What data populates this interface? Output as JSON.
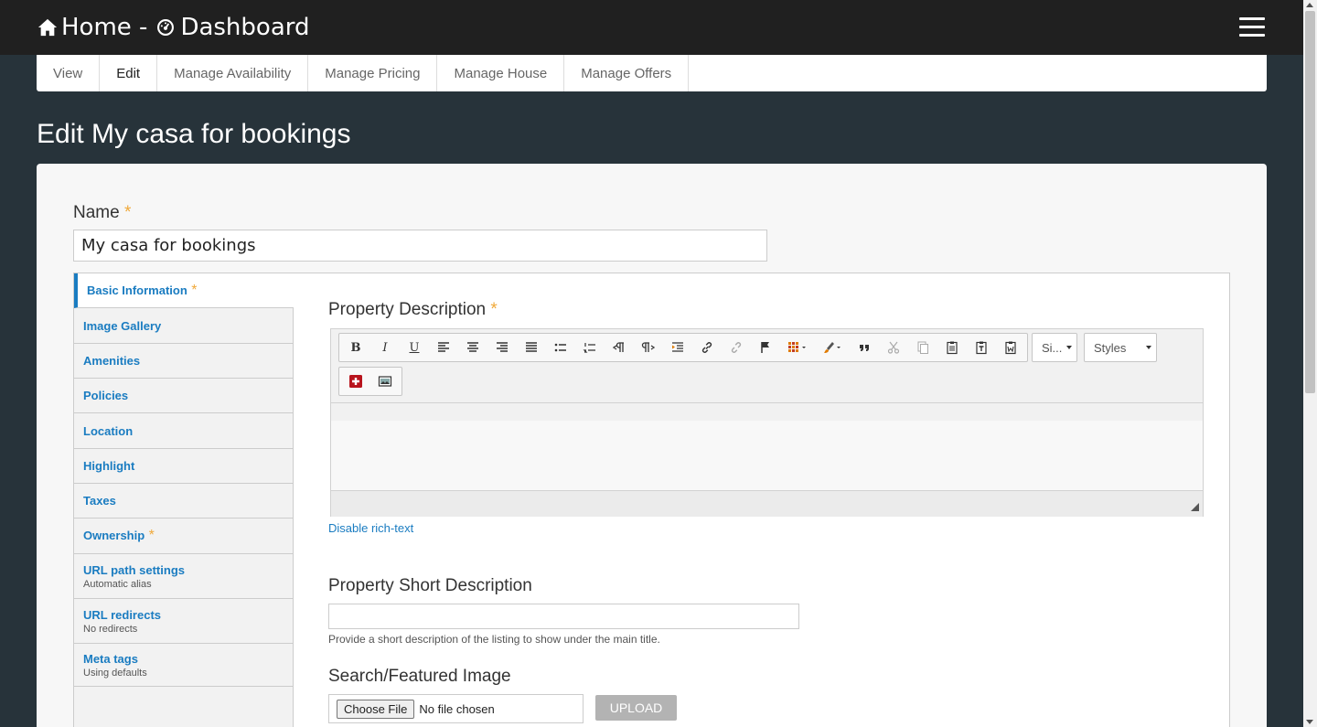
{
  "header": {
    "home_label": "Home -",
    "dashboard_label": "Dashboard"
  },
  "tabs": [
    {
      "label": "View"
    },
    {
      "label": "Edit",
      "active": true
    },
    {
      "label": "Manage Availability"
    },
    {
      "label": "Manage Pricing"
    },
    {
      "label": "Manage House"
    },
    {
      "label": "Manage Offers"
    }
  ],
  "page": {
    "title": "Edit My casa for bookings"
  },
  "form": {
    "name_label": "Name",
    "required_mark": "*",
    "name_value": "My casa for bookings"
  },
  "vertical_tabs": [
    {
      "label": "Basic Information",
      "required": "*",
      "summary": "",
      "active": true
    },
    {
      "label": "Image Gallery",
      "required": "",
      "summary": ""
    },
    {
      "label": "Amenities",
      "required": "",
      "summary": ""
    },
    {
      "label": "Policies",
      "required": "",
      "summary": ""
    },
    {
      "label": "Location",
      "required": "",
      "summary": ""
    },
    {
      "label": "Highlight",
      "required": "",
      "summary": ""
    },
    {
      "label": "Taxes",
      "required": "",
      "summary": ""
    },
    {
      "label": "Ownership",
      "required": "*",
      "summary": ""
    },
    {
      "label": "URL path settings",
      "required": "",
      "summary": "Automatic alias"
    },
    {
      "label": "URL redirects",
      "required": "",
      "summary": "No redirects"
    },
    {
      "label": "Meta tags",
      "required": "",
      "summary": "Using defaults"
    }
  ],
  "description": {
    "label": "Property Description",
    "size_dropdown": "Si...",
    "styles_dropdown": "Styles",
    "disable_rich_text": "Disable rich-text"
  },
  "short_description": {
    "label": "Property Short Description",
    "value": "",
    "help": "Provide a short description of the listing to show under the main title."
  },
  "featured_image": {
    "label": "Search/Featured Image",
    "choose_button": "Choose File",
    "no_file": "No file chosen",
    "upload_button": "UPLOAD"
  },
  "toolbar_icons": [
    "bold-icon",
    "italic-icon",
    "underline-icon",
    "align-left-icon",
    "align-center-icon",
    "align-right-icon",
    "justify-icon",
    "bulleted-list-icon",
    "numbered-list-icon",
    "ltr-icon",
    "rtl-icon",
    "indent-icon",
    "link-icon",
    "unlink-icon",
    "anchor-icon",
    "table-icon",
    "text-color-icon",
    "blockquote-icon",
    "cut-icon",
    "copy-icon",
    "paste-icon",
    "paste-text-icon",
    "paste-word-icon",
    "insert-icon",
    "image-icon"
  ],
  "colors": {
    "accent": "#1a7cc1",
    "required": "#f0a93a",
    "topbar": "#202020",
    "background": "#27333a"
  }
}
